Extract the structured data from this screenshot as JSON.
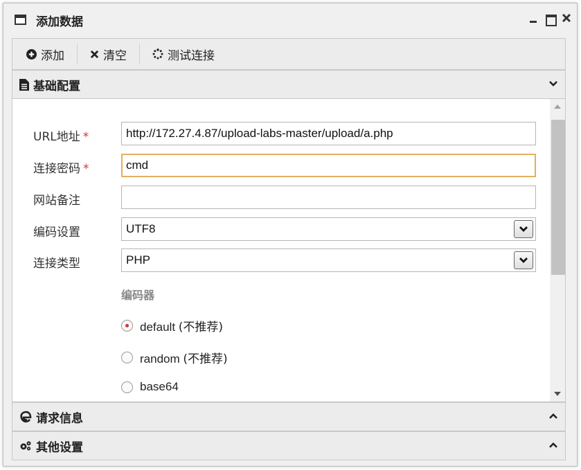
{
  "window": {
    "title": "添加数据"
  },
  "toolbar": {
    "add_label": "添加",
    "clear_label": "清空",
    "test_label": "测试连接"
  },
  "panels": {
    "basic": "基础配置",
    "request": "请求信息",
    "other": "其他设置"
  },
  "form": {
    "url": {
      "label": "URL地址",
      "required": "*",
      "value": "http://172.27.4.87/upload-labs-master/upload/a.php"
    },
    "password": {
      "label": "连接密码",
      "required": "*",
      "value": "cmd"
    },
    "note": {
      "label": "网站备注",
      "value": ""
    },
    "encoding": {
      "label": "编码设置",
      "value": "UTF8"
    },
    "type": {
      "label": "连接类型",
      "value": "PHP"
    },
    "encoder": {
      "heading": "编码器",
      "options": [
        {
          "name": "default",
          "note": "(不推荐)",
          "checked": true
        },
        {
          "name": "random",
          "note": "(不推荐)",
          "checked": false
        },
        {
          "name": "base64",
          "note": "",
          "checked": false
        }
      ]
    }
  },
  "colors": {
    "required": "#d9342b",
    "focus_border": "#e0b060",
    "radio_checked": "#d9342b"
  }
}
